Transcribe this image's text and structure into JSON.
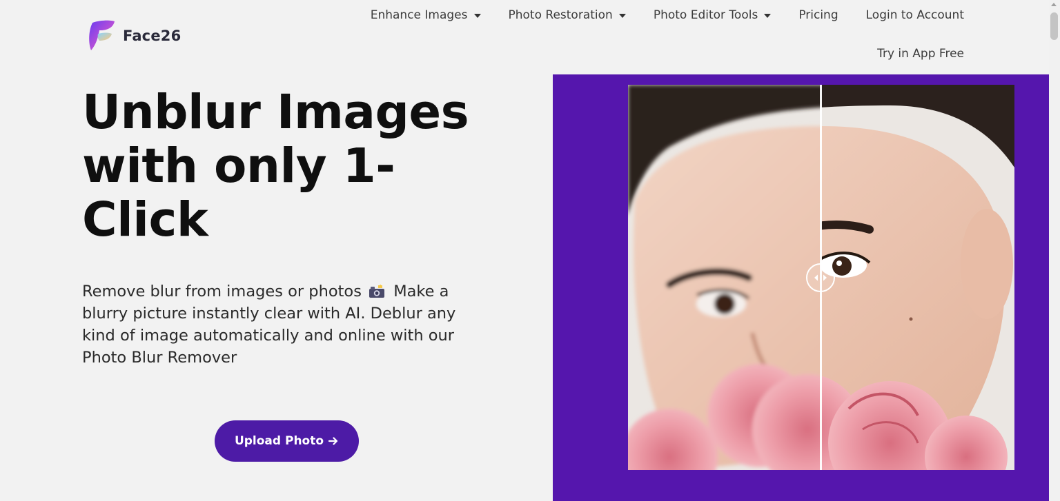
{
  "brand": {
    "name": "Face26",
    "logo_icon": "face26-logo-icon"
  },
  "nav": {
    "items": [
      {
        "label": "Enhance Images",
        "has_dropdown": true
      },
      {
        "label": "Photo Restoration",
        "has_dropdown": true
      },
      {
        "label": "Photo Editor Tools",
        "has_dropdown": true
      },
      {
        "label": "Pricing",
        "has_dropdown": false
      },
      {
        "label": "Login to Account",
        "has_dropdown": false
      }
    ],
    "secondary": "Try in App Free"
  },
  "hero": {
    "title": "Unblur Images with only 1-Click",
    "subtitle_part1": "Remove blur from images or photos",
    "subtitle_emoji_icon": "camera-flash-icon",
    "subtitle_part2": "Make a blurry picture instantly clear with AI. Deblur any kind of image automatically and online with our Photo Blur Remover",
    "cta_label": "Upload Photo",
    "cta_icon": "arrow-right-icon"
  },
  "comparison": {
    "handle_icon": "left-right-arrows-icon",
    "split_fraction": 0.5
  },
  "colors": {
    "accent": "#4d1ba6",
    "panel": "#5516ad",
    "background": "#f2f2f2",
    "text": "#0f0f0f"
  }
}
